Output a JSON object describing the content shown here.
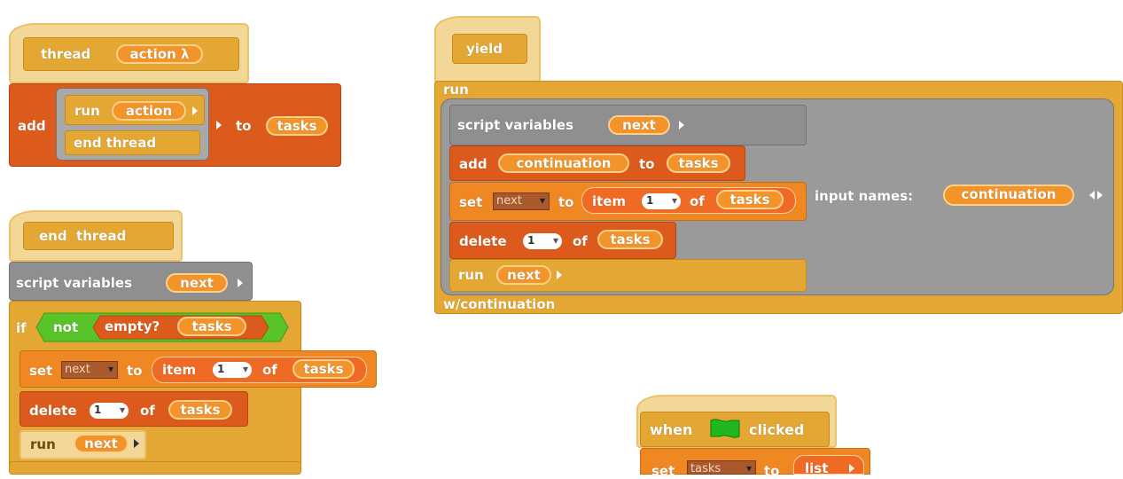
{
  "thread_block": {
    "hat_word": "thread",
    "hat_param": "action λ",
    "add_label": "add",
    "run_label": "run",
    "run_arg": "action",
    "end_thread": "end thread",
    "to_label": "to",
    "list_name": "tasks"
  },
  "end_thread_block": {
    "hat_label": "end  thread",
    "script_variables": "script variables",
    "var_name": "next",
    "if_label": "if",
    "not_label": "not",
    "empty_label": "empty?",
    "list_name": "tasks",
    "set_label": "set",
    "set_var": "next",
    "to_label": "to",
    "item_label": "item",
    "item_index": "1",
    "of_label": "of",
    "delete_label": "delete",
    "run_label": "run",
    "run_arg": "next"
  },
  "yield_block": {
    "hat_label": "yield",
    "run_label": "run",
    "script_variables": "script variables",
    "var_name": "next",
    "add_label": "add",
    "continuation": "continuation",
    "to_label": "to",
    "list_name": "tasks",
    "set_label": "set",
    "set_var": "next",
    "item_label": "item",
    "item_index": "1",
    "of_label": "of",
    "delete_label": "delete",
    "run_arg": "next",
    "input_names_label": "input names:",
    "input_name": "continuation",
    "footer": "w/continuation"
  },
  "flag_block": {
    "when_label": "when",
    "clicked_label": "clicked",
    "set_label": "set",
    "set_var": "tasks",
    "to_label": "to",
    "list_label": "list",
    "flag_color": "#1fb81f"
  },
  "colors": {
    "hat": "#f3d797",
    "control": "#e4a733",
    "lists": "#dc5b1c",
    "variables": "#ef8722",
    "gray_ring": "#8f8f8f",
    "operators": "#58c42a"
  }
}
